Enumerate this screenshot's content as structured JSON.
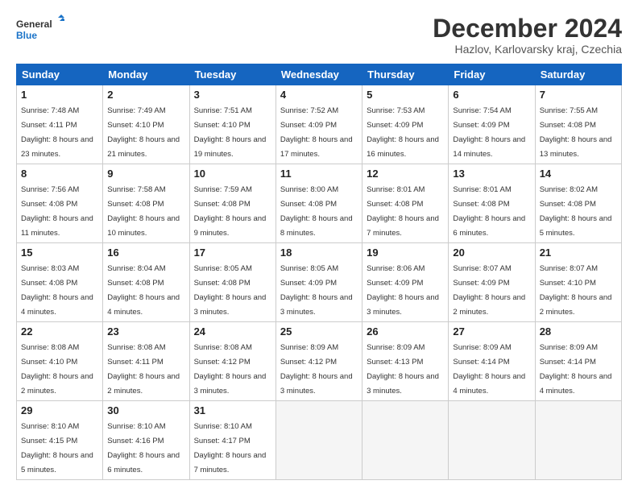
{
  "header": {
    "logo_line1": "General",
    "logo_line2": "Blue",
    "title": "December 2024",
    "location": "Hazlov, Karlovarsky kraj, Czechia"
  },
  "weekdays": [
    "Sunday",
    "Monday",
    "Tuesday",
    "Wednesday",
    "Thursday",
    "Friday",
    "Saturday"
  ],
  "weeks": [
    [
      {
        "day": "1",
        "sunrise": "7:48 AM",
        "sunset": "4:11 PM",
        "daylight": "8 hours and 23 minutes."
      },
      {
        "day": "2",
        "sunrise": "7:49 AM",
        "sunset": "4:10 PM",
        "daylight": "8 hours and 21 minutes."
      },
      {
        "day": "3",
        "sunrise": "7:51 AM",
        "sunset": "4:10 PM",
        "daylight": "8 hours and 19 minutes."
      },
      {
        "day": "4",
        "sunrise": "7:52 AM",
        "sunset": "4:09 PM",
        "daylight": "8 hours and 17 minutes."
      },
      {
        "day": "5",
        "sunrise": "7:53 AM",
        "sunset": "4:09 PM",
        "daylight": "8 hours and 16 minutes."
      },
      {
        "day": "6",
        "sunrise": "7:54 AM",
        "sunset": "4:09 PM",
        "daylight": "8 hours and 14 minutes."
      },
      {
        "day": "7",
        "sunrise": "7:55 AM",
        "sunset": "4:08 PM",
        "daylight": "8 hours and 13 minutes."
      }
    ],
    [
      {
        "day": "8",
        "sunrise": "7:56 AM",
        "sunset": "4:08 PM",
        "daylight": "8 hours and 11 minutes."
      },
      {
        "day": "9",
        "sunrise": "7:58 AM",
        "sunset": "4:08 PM",
        "daylight": "8 hours and 10 minutes."
      },
      {
        "day": "10",
        "sunrise": "7:59 AM",
        "sunset": "4:08 PM",
        "daylight": "8 hours and 9 minutes."
      },
      {
        "day": "11",
        "sunrise": "8:00 AM",
        "sunset": "4:08 PM",
        "daylight": "8 hours and 8 minutes."
      },
      {
        "day": "12",
        "sunrise": "8:01 AM",
        "sunset": "4:08 PM",
        "daylight": "8 hours and 7 minutes."
      },
      {
        "day": "13",
        "sunrise": "8:01 AM",
        "sunset": "4:08 PM",
        "daylight": "8 hours and 6 minutes."
      },
      {
        "day": "14",
        "sunrise": "8:02 AM",
        "sunset": "4:08 PM",
        "daylight": "8 hours and 5 minutes."
      }
    ],
    [
      {
        "day": "15",
        "sunrise": "8:03 AM",
        "sunset": "4:08 PM",
        "daylight": "8 hours and 4 minutes."
      },
      {
        "day": "16",
        "sunrise": "8:04 AM",
        "sunset": "4:08 PM",
        "daylight": "8 hours and 4 minutes."
      },
      {
        "day": "17",
        "sunrise": "8:05 AM",
        "sunset": "4:08 PM",
        "daylight": "8 hours and 3 minutes."
      },
      {
        "day": "18",
        "sunrise": "8:05 AM",
        "sunset": "4:09 PM",
        "daylight": "8 hours and 3 minutes."
      },
      {
        "day": "19",
        "sunrise": "8:06 AM",
        "sunset": "4:09 PM",
        "daylight": "8 hours and 3 minutes."
      },
      {
        "day": "20",
        "sunrise": "8:07 AM",
        "sunset": "4:09 PM",
        "daylight": "8 hours and 2 minutes."
      },
      {
        "day": "21",
        "sunrise": "8:07 AM",
        "sunset": "4:10 PM",
        "daylight": "8 hours and 2 minutes."
      }
    ],
    [
      {
        "day": "22",
        "sunrise": "8:08 AM",
        "sunset": "4:10 PM",
        "daylight": "8 hours and 2 minutes."
      },
      {
        "day": "23",
        "sunrise": "8:08 AM",
        "sunset": "4:11 PM",
        "daylight": "8 hours and 2 minutes."
      },
      {
        "day": "24",
        "sunrise": "8:08 AM",
        "sunset": "4:12 PM",
        "daylight": "8 hours and 3 minutes."
      },
      {
        "day": "25",
        "sunrise": "8:09 AM",
        "sunset": "4:12 PM",
        "daylight": "8 hours and 3 minutes."
      },
      {
        "day": "26",
        "sunrise": "8:09 AM",
        "sunset": "4:13 PM",
        "daylight": "8 hours and 3 minutes."
      },
      {
        "day": "27",
        "sunrise": "8:09 AM",
        "sunset": "4:14 PM",
        "daylight": "8 hours and 4 minutes."
      },
      {
        "day": "28",
        "sunrise": "8:09 AM",
        "sunset": "4:14 PM",
        "daylight": "8 hours and 4 minutes."
      }
    ],
    [
      {
        "day": "29",
        "sunrise": "8:10 AM",
        "sunset": "4:15 PM",
        "daylight": "8 hours and 5 minutes."
      },
      {
        "day": "30",
        "sunrise": "8:10 AM",
        "sunset": "4:16 PM",
        "daylight": "8 hours and 6 minutes."
      },
      {
        "day": "31",
        "sunrise": "8:10 AM",
        "sunset": "4:17 PM",
        "daylight": "8 hours and 7 minutes."
      },
      null,
      null,
      null,
      null
    ]
  ]
}
